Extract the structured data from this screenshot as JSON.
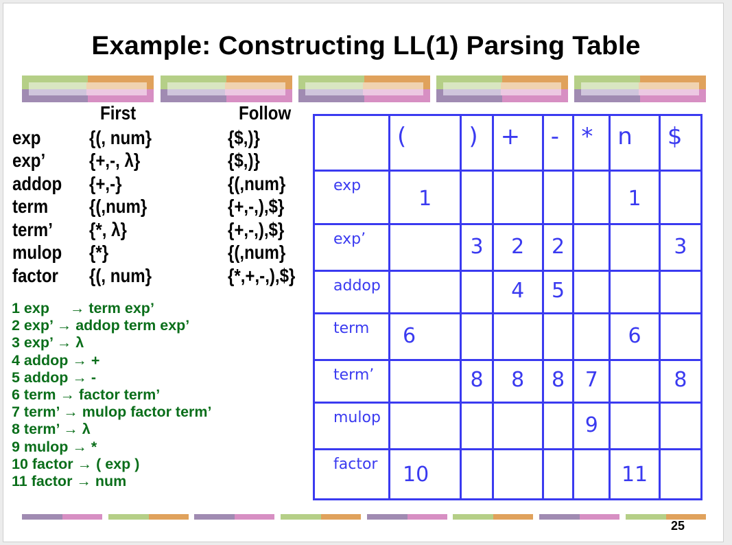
{
  "slide": {
    "title": "Example: Constructing LL(1) Parsing Table",
    "page_number": "25",
    "colors": {
      "title": "#000000",
      "productions": "#0a6e1a",
      "table": "#3a3af0",
      "banner_green": "#b5cf87",
      "banner_orange": "#e0a25c",
      "banner_purple": "#a08bb2",
      "banner_pink": "#d78fc3"
    }
  },
  "first_follow": {
    "headers": {
      "first": "First",
      "follow": "Follow"
    },
    "rows": [
      {
        "nonterminal": "exp",
        "first": "{(, num}",
        "follow": "{$,)}"
      },
      {
        "nonterminal": "exp’",
        "first": "{+,-, λ}",
        "follow": "{$,)}"
      },
      {
        "nonterminal": "addop",
        "first": "{+,-}",
        "follow": "{(,num}"
      },
      {
        "nonterminal": "term",
        "first": "{(,num}",
        "follow": "{+,-,),$}"
      },
      {
        "nonterminal": "term’",
        "first": "{*, λ}",
        "follow": "{+,-,),$}"
      },
      {
        "nonterminal": "mulop",
        "first": "{*}",
        "follow": "{(,num}"
      },
      {
        "nonterminal": "factor",
        "first": "{(, num}",
        "follow": "{*,+,-,),$}"
      }
    ]
  },
  "productions": [
    "1 exp     → term exp’",
    "2 exp’ → addop term exp’",
    "3 exp’ → λ",
    "4 addop → +",
    "5 addop → -",
    "6 term → factor term’",
    "7 term’ → mulop factor term’",
    "8 term’ → λ",
    "9 mulop → *",
    "10 factor → ( exp )",
    "11 factor → num"
  ],
  "parse_table": {
    "columns": [
      "(",
      ")",
      "+",
      "-",
      "*",
      "n",
      "$"
    ],
    "rows": [
      {
        "nonterminal": "exp",
        "cells": [
          "1",
          "",
          "",
          "",
          "",
          "1",
          ""
        ]
      },
      {
        "nonterminal": "exp’",
        "cells": [
          "",
          "3",
          "2",
          "2",
          "",
          "",
          "3"
        ]
      },
      {
        "nonterminal": "addop",
        "cells": [
          "",
          "",
          "4",
          "5",
          "",
          "",
          ""
        ]
      },
      {
        "nonterminal": "term",
        "cells": [
          "6",
          "",
          "",
          "",
          "",
          "6",
          ""
        ]
      },
      {
        "nonterminal": "term’",
        "cells": [
          "",
          "8",
          "8",
          "8",
          "7",
          "",
          "8"
        ]
      },
      {
        "nonterminal": "mulop",
        "cells": [
          "",
          "",
          "",
          "",
          "9",
          "",
          ""
        ]
      },
      {
        "nonterminal": "factor",
        "cells": [
          "10",
          "",
          "",
          "",
          "",
          "11",
          ""
        ]
      }
    ]
  }
}
